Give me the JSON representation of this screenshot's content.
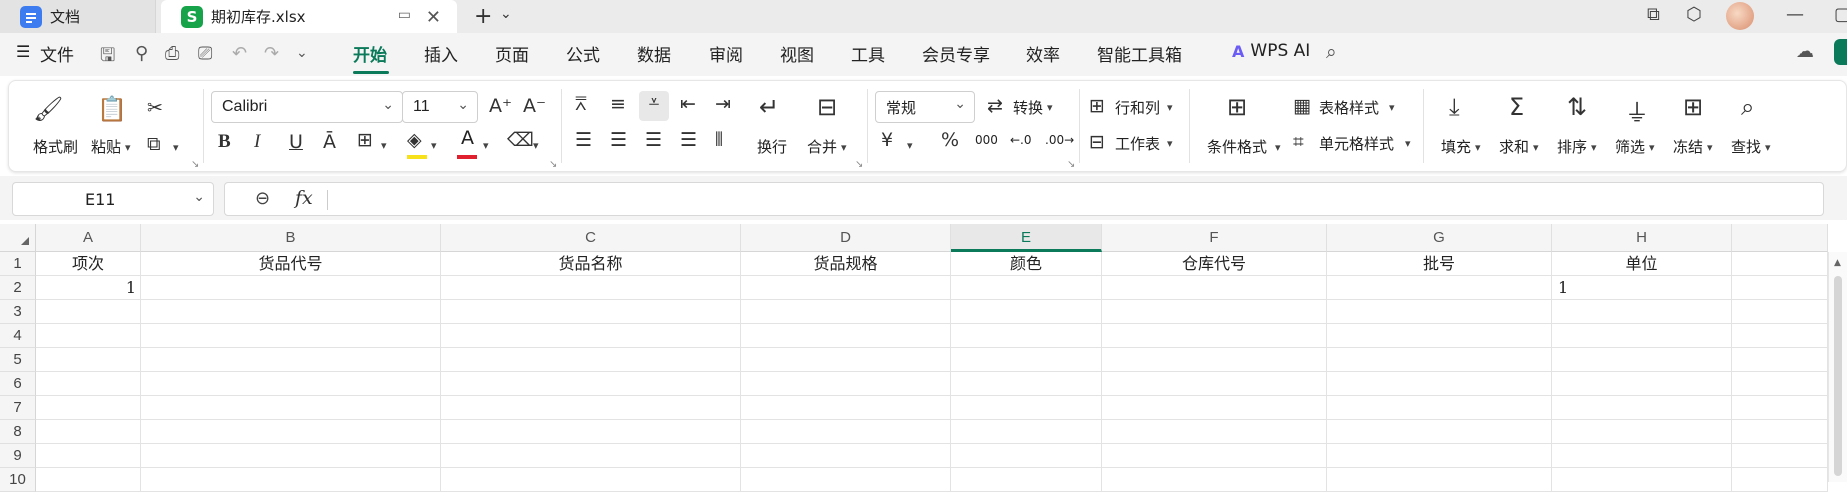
{
  "titlebar": {
    "tabs": [
      {
        "label": "文档",
        "icon": "doc-icon"
      },
      {
        "label": "期初库存.xlsx",
        "icon": "xls-icon",
        "glyph": "S"
      }
    ]
  },
  "menubar": {
    "file_label": "文件",
    "tabs": [
      "开始",
      "插入",
      "页面",
      "公式",
      "数据",
      "审阅",
      "视图",
      "工具",
      "会员专享",
      "效率",
      "智能工具箱"
    ],
    "active_tab": "开始",
    "wps_ai": "WPS AI"
  },
  "ribbon": {
    "format_painter": "格式刷",
    "paste": "粘贴",
    "font_name": "Calibri",
    "font_size": "11",
    "wrap": "换行",
    "merge": "合并",
    "number_format": "常规",
    "convert": "转换",
    "row_col": "行和列",
    "worksheet": "工作表",
    "cond_format": "条件格式",
    "table_style": "表格样式",
    "cell_style": "单元格样式",
    "fill": "填充",
    "sum": "求和",
    "sort": "排序",
    "filter": "筛选",
    "freeze": "冻结",
    "find": "查找",
    "currency_symbol": "¥",
    "percent_symbol": "%",
    "thousands_symbol": "000",
    "bold": "B",
    "italic": "I",
    "underline": "U",
    "strike": "Ā",
    "font_color_letter": "A",
    "colors": {
      "accent": "#0b7a5a",
      "highlight": "#f7e11a",
      "font_color": "#e0202e"
    }
  },
  "formula_bar": {
    "cell_ref": "E11",
    "fx": "fx",
    "formula": ""
  },
  "sheet": {
    "columns": [
      "A",
      "B",
      "C",
      "D",
      "E",
      "F",
      "G",
      "H"
    ],
    "selected_column": "E",
    "rows": [
      "1",
      "2",
      "3",
      "4",
      "5",
      "6",
      "7",
      "8",
      "9",
      "10"
    ],
    "headers": [
      "项次",
      "货品代号",
      "货品名称",
      "货品规格",
      "颜色",
      "仓库代号",
      "批号",
      "单位"
    ],
    "row2": {
      "A": "1",
      "H": "1"
    }
  }
}
